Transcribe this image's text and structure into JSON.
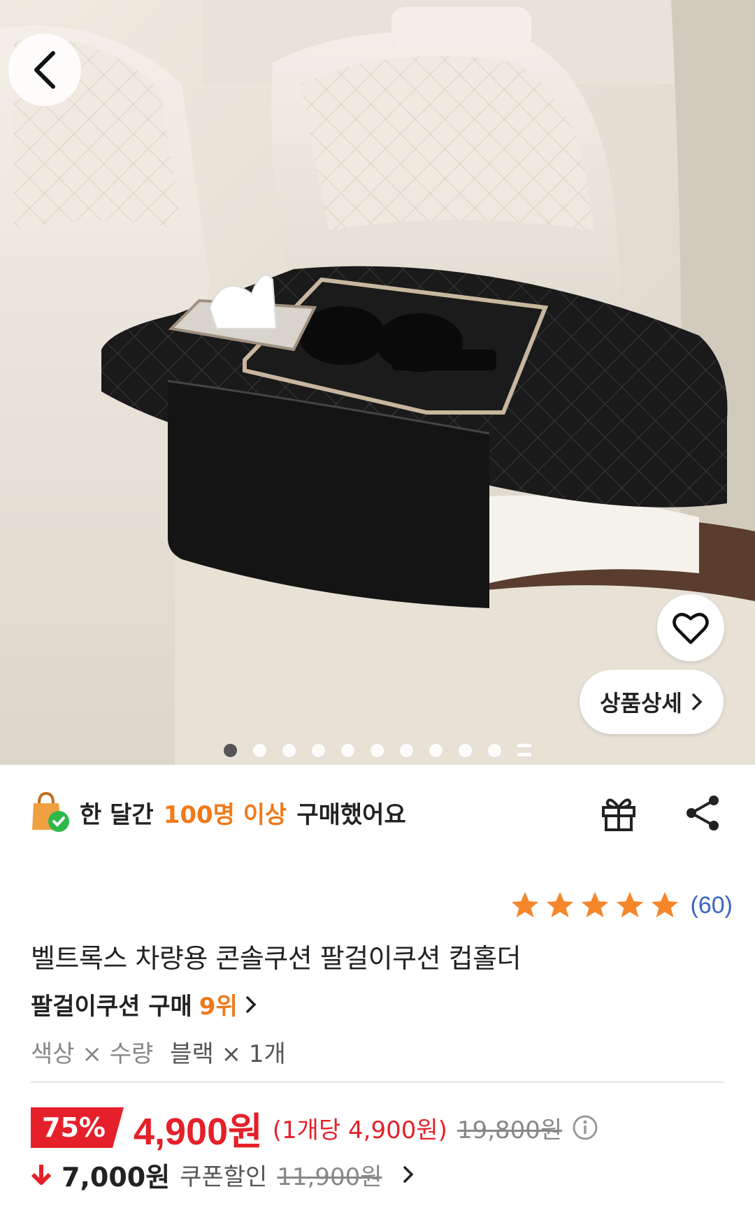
{
  "hero": {
    "image_description_icon": "armrest-console-cushion-photo",
    "detail_button_label": "상품상세",
    "page_dots_total": 10,
    "page_dots_active_index": 0
  },
  "banner": {
    "prefix": "한 달간",
    "highlight": "100명 이상",
    "suffix": "구매했어요"
  },
  "rating": {
    "stars": 5,
    "count": "(60)"
  },
  "product": {
    "title": "벨트록스 차량용 콘솔쿠션 팔걸이쿠션 컵홀더",
    "rank_prefix": "팔걸이쿠션 구매",
    "rank_value": "9위",
    "option_label": "색상 × 수량",
    "option_value": "블랙 × 1개"
  },
  "price": {
    "discount": "75%",
    "current": "4,900원",
    "per_unit": "(1개당 4,900원)",
    "original": "19,800원"
  },
  "coupon": {
    "amount": "7,000원",
    "label": "쿠폰할인",
    "original": "11,900원"
  },
  "colors": {
    "accent_orange": "#f07a1a",
    "price_red": "#e5202a",
    "link_blue": "#3a66c4"
  }
}
